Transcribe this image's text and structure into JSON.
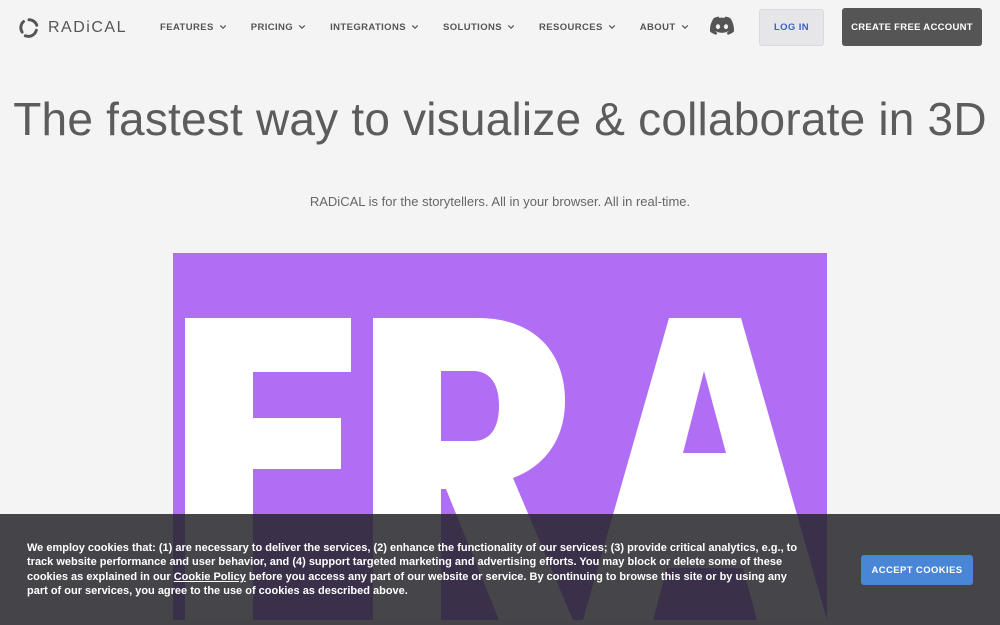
{
  "brand": {
    "name": "RADiCAL"
  },
  "nav": {
    "items": [
      {
        "label": "FEATURES"
      },
      {
        "label": "PRICING"
      },
      {
        "label": "INTEGRATIONS"
      },
      {
        "label": "SOLUTIONS"
      },
      {
        "label": "RESOURCES"
      },
      {
        "label": "ABOUT"
      }
    ],
    "discord_icon": "discord-icon",
    "login_label": "LOG IN",
    "signup_label": "CREATE FREE ACCOUNT"
  },
  "hero": {
    "title": "The fastest way to visualize & collaborate in 3D",
    "subtitle": "RADiCAL is for the storytellers. All in your browser. All in real-time."
  },
  "media": {
    "text": "ERA",
    "background": "#b06ef5"
  },
  "cookie": {
    "text_before": "We employ cookies that: (1) are necessary to deliver the services, (2) enhance the functionality of our services; (3) provide critical analytics, e.g., to track website performance and user behavior, and (4) support targeted marketing and advertising efforts. You may block or delete some of these cookies as explained in our ",
    "link_label": "Cookie Policy",
    "text_after": " before you access any part of our website or service. By continuing to browse this site or by using any part of our services, you agree to the use of cookies as described above.",
    "accept_label": "ACCEPT COOKIES"
  },
  "colors": {
    "accent": "#4a86d6",
    "login_text": "#3b62c9",
    "dark_button": "#555555",
    "media_purple": "#b06ef5"
  }
}
